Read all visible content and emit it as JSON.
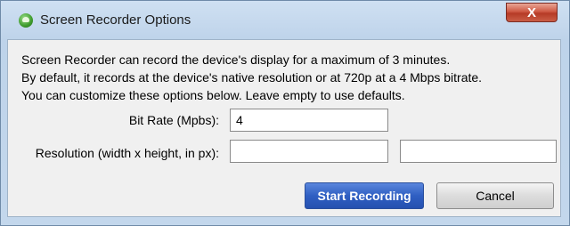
{
  "window": {
    "title": "Screen Recorder Options",
    "close_label": "X",
    "icon": "android-icon"
  },
  "description": {
    "line1": "Screen Recorder can record the device's display for a maximum of 3 minutes.",
    "line2": "By default, it records at the device's native resolution or at 720p at a 4 Mbps bitrate.",
    "line3": "You can customize these options below. Leave empty to use defaults."
  },
  "form": {
    "bit_rate_label": "Bit Rate (Mpbs):",
    "bit_rate_value": "4",
    "resolution_label": "Resolution (width x height, in px):",
    "width_value": "",
    "height_value": ""
  },
  "buttons": {
    "start_label": "Start Recording",
    "cancel_label": "Cancel"
  },
  "colors": {
    "primary_button": "#2f5fc2",
    "close_button": "#c44a35",
    "title_bar": "#c3d7ec"
  }
}
